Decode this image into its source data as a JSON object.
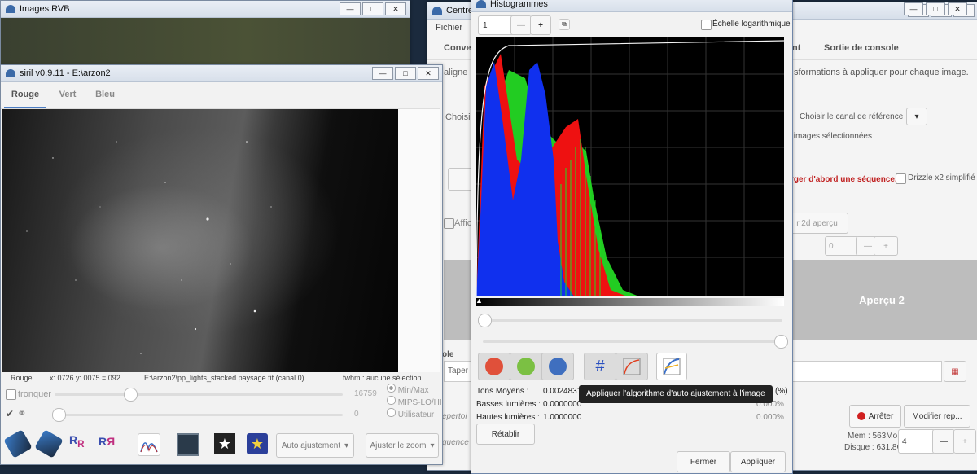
{
  "rgb_window": {
    "title": "Images RVB"
  },
  "siril_window": {
    "title": "siril v0.9.11 - E:\\arzon2",
    "tabs": [
      "Rouge",
      "Vert",
      "Bleu"
    ],
    "status": {
      "channel": "Rouge",
      "coords": "x: 0726 y: 0075 = 092",
      "file": "E:\\arzon2\\pp_lights_stacked paysage.fit (canal 0)",
      "fwhm": "fwhm : aucune sélection"
    },
    "tronquer_label": "tronquer",
    "slider_max_value": "16759",
    "slider_min_value": "0",
    "radio_options": [
      "Min/Max",
      "MIPS-LO/HI",
      "Utilisateur"
    ],
    "auto_select": "Auto ajustement",
    "zoom_select": "Ajuster le zoom"
  },
  "centre_window": {
    "title": "Centre",
    "menu": [
      "Fichier"
    ],
    "tab_partial_left": "Conve",
    "tab_partial_right": "nt",
    "tab_console": "Sortie de console",
    "partial_texts": {
      "aligne": "aligne",
      "choisir_left": "Choisir",
      "transform": "sformations à appliquer pour chaque image.",
      "ref_channel": "Choisir le canal de référence :",
      "selected": "s images sélectionnées",
      "warning": "rger d'abord une séquence.",
      "drizzle": "Drizzle x2 simplifié",
      "affich": "Affich",
      "apercu_btn": "r 2d aperçu",
      "spin_value": "0",
      "apercu2": "Aperçu 2",
      "ole": "ole",
      "taper": "Taper",
      "repertoi": "epertoi",
      "sequence": "quence"
    },
    "stop_button": "Arrêter",
    "modify_button": "Modifier rep...",
    "mem": "Mem : 563Mo",
    "disk": "Disque : 631.8G",
    "thread_value": "4"
  },
  "histogram_window": {
    "title": "Histogrammes",
    "zoom_value": "1",
    "log_label": "Échelle logarithmique",
    "stats": {
      "tons_moyens_label": "Tons Moyens :",
      "tons_moyens_value": "0.0024831",
      "basses_label": "Basses lumières :",
      "basses_value": "0.0000000",
      "hautes_label": "Hautes lumières :",
      "hautes_value": "1.0000000",
      "perte_label": "erte (%)",
      "perte_basses": "0.000%",
      "perte_hautes": "0.000%"
    },
    "tooltip": "Appliquer l'algorithme d'auto ajustement à l'image",
    "reset_button": "Rétablir",
    "close_button": "Fermer",
    "apply_button": "Appliquer",
    "colors": {
      "red": "#e0503a",
      "green": "#7bc043",
      "blue": "#3f6fbf"
    }
  }
}
